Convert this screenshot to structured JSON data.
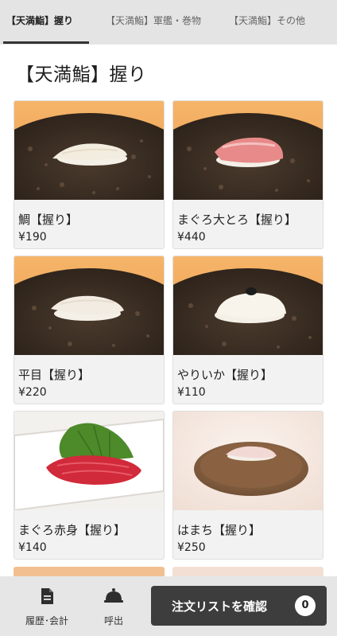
{
  "tabs": [
    {
      "label": "【天満鮨】握り"
    },
    {
      "label": "【天満鮨】軍艦・巻物"
    },
    {
      "label": "【天満鮨】その他"
    }
  ],
  "section_title": "【天満鮨】握り",
  "items": [
    {
      "name": "鯛【握り】",
      "price": "¥190"
    },
    {
      "name": "まぐろ大とろ【握り】",
      "price": "¥440"
    },
    {
      "name": "平目【握り】",
      "price": "¥220"
    },
    {
      "name": "やりいか【握り】",
      "price": "¥110"
    },
    {
      "name": "まぐろ赤身【握り】",
      "price": "¥140"
    },
    {
      "name": "はまち【握り】",
      "price": "¥250"
    }
  ],
  "bottom": {
    "history_label": "履歴･会計",
    "call_label": "呼出",
    "order_label": "注文リストを確認",
    "order_count": "0"
  },
  "icons": {
    "history": "receipt-icon",
    "call": "service-bell-icon"
  },
  "colors": {
    "order_button": "#3d3d3d",
    "tab_bar": "#e4e4e4",
    "bottom_bar": "#e6e6e6"
  }
}
